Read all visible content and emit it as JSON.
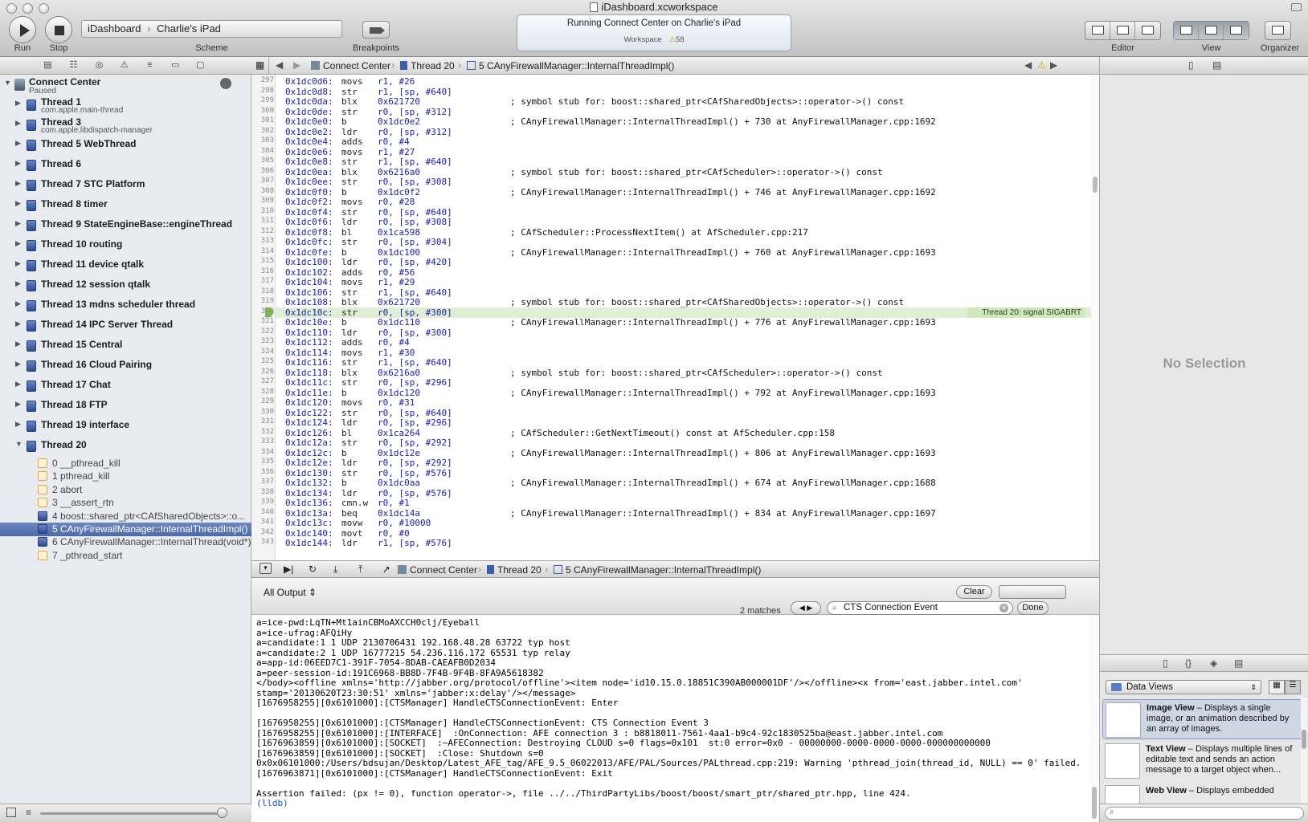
{
  "window": {
    "title": "iDashboard.xcworkspace"
  },
  "toolbar": {
    "run_label": "Run",
    "stop_label": "Stop",
    "scheme": {
      "project": "iDashboard",
      "device": "Charlie's iPad",
      "caption": "Scheme"
    },
    "breakpoints_label": "Breakpoints",
    "activity": {
      "status": "Running Connect Center on Charlie's iPad",
      "workspace_label": "Workspace",
      "warning_count": "58"
    },
    "editor_label": "Editor",
    "view_label": "View",
    "organizer_label": "Organizer"
  },
  "navigator": {
    "process": {
      "name": "Connect Center",
      "state": "Paused"
    },
    "threads": [
      {
        "name": "Thread 1",
        "sub": "com.apple.main-thread"
      },
      {
        "name": "Thread 3",
        "sub": "com.apple.libdispatch-manager"
      },
      {
        "name": "Thread 5 WebThread",
        "sub": ""
      },
      {
        "name": "Thread 6",
        "sub": ""
      },
      {
        "name": "Thread 7 STC Platform",
        "sub": ""
      },
      {
        "name": "Thread 8 timer",
        "sub": ""
      },
      {
        "name": "Thread 9 StateEngineBase::engineThread",
        "sub": ""
      },
      {
        "name": "Thread 10 routing",
        "sub": ""
      },
      {
        "name": "Thread 11 device qtalk",
        "sub": ""
      },
      {
        "name": "Thread 12 session qtalk",
        "sub": ""
      },
      {
        "name": "Thread 13 mdns scheduler thread",
        "sub": ""
      },
      {
        "name": "Thread 14 IPC Server Thread",
        "sub": ""
      },
      {
        "name": "Thread 15 Central",
        "sub": ""
      },
      {
        "name": "Thread 16 Cloud Pairing",
        "sub": ""
      },
      {
        "name": "Thread 17 Chat",
        "sub": ""
      },
      {
        "name": "Thread 18 FTP",
        "sub": ""
      },
      {
        "name": "Thread 19 interface",
        "sub": ""
      },
      {
        "name": "Thread 20",
        "sub": ""
      }
    ],
    "frames": [
      {
        "label": "0 __pthread_kill",
        "user": false
      },
      {
        "label": "1 pthread_kill",
        "user": false
      },
      {
        "label": "2 abort",
        "user": false
      },
      {
        "label": "3 __assert_rtn",
        "user": false
      },
      {
        "label": "4 boost::shared_ptr<CAfSharedObjects>::o...",
        "user": true
      },
      {
        "label": "5 CAnyFirewallManager::InternalThreadImpl()",
        "user": true
      },
      {
        "label": "6 CAnyFirewallManager::InternalThread(void*)",
        "user": true
      },
      {
        "label": "7 _pthread_start",
        "user": false
      }
    ]
  },
  "editor": {
    "jumpbar": {
      "project": "Connect Center",
      "thread": "Thread 20",
      "frame": "5 CAnyFirewallManager::InternalThreadImpl()"
    },
    "signal_label": "Thread 20: signal SIGABRT",
    "lines": [
      {
        "n": "297",
        "addr": "0x1dc0d6:",
        "op": "movs",
        "args": "r1, #26",
        "cm": ""
      },
      {
        "n": "298",
        "addr": "0x1dc0d8:",
        "op": "str",
        "args": "r1, [sp, #640]",
        "cm": ""
      },
      {
        "n": "299",
        "addr": "0x1dc0da:",
        "op": "blx",
        "args": "0x621720",
        "cm": "; symbol stub for: boost::shared_ptr<CAfSharedObjects>::operator->() const"
      },
      {
        "n": "300",
        "addr": "0x1dc0de:",
        "op": "str",
        "args": "r0, [sp, #312]",
        "cm": ""
      },
      {
        "n": "301",
        "addr": "0x1dc0e0:",
        "op": "b",
        "args": "0x1dc0e2",
        "cm": "; CAnyFirewallManager::InternalThreadImpl() + 730 at AnyFirewallManager.cpp:1692"
      },
      {
        "n": "302",
        "addr": "0x1dc0e2:",
        "op": "ldr",
        "args": "r0, [sp, #312]",
        "cm": ""
      },
      {
        "n": "303",
        "addr": "0x1dc0e4:",
        "op": "adds",
        "args": "r0, #4",
        "cm": ""
      },
      {
        "n": "304",
        "addr": "0x1dc0e6:",
        "op": "movs",
        "args": "r1, #27",
        "cm": ""
      },
      {
        "n": "305",
        "addr": "0x1dc0e8:",
        "op": "str",
        "args": "r1, [sp, #640]",
        "cm": ""
      },
      {
        "n": "306",
        "addr": "0x1dc0ea:",
        "op": "blx",
        "args": "0x6216a0",
        "cm": "; symbol stub for: boost::shared_ptr<CAfScheduler>::operator->() const"
      },
      {
        "n": "307",
        "addr": "0x1dc0ee:",
        "op": "str",
        "args": "r0, [sp, #308]",
        "cm": ""
      },
      {
        "n": "308",
        "addr": "0x1dc0f0:",
        "op": "b",
        "args": "0x1dc0f2",
        "cm": "; CAnyFirewallManager::InternalThreadImpl() + 746 at AnyFirewallManager.cpp:1692"
      },
      {
        "n": "309",
        "addr": "0x1dc0f2:",
        "op": "movs",
        "args": "r0, #28",
        "cm": ""
      },
      {
        "n": "310",
        "addr": "0x1dc0f4:",
        "op": "str",
        "args": "r0, [sp, #640]",
        "cm": ""
      },
      {
        "n": "311",
        "addr": "0x1dc0f6:",
        "op": "ldr",
        "args": "r0, [sp, #308]",
        "cm": ""
      },
      {
        "n": "312",
        "addr": "0x1dc0f8:",
        "op": "bl",
        "args": "0x1ca598",
        "cm": "; CAfScheduler::ProcessNextItem() at AfScheduler.cpp:217"
      },
      {
        "n": "313",
        "addr": "0x1dc0fc:",
        "op": "str",
        "args": "r0, [sp, #304]",
        "cm": ""
      },
      {
        "n": "314",
        "addr": "0x1dc0fe:",
        "op": "b",
        "args": "0x1dc100",
        "cm": "; CAnyFirewallManager::InternalThreadImpl() + 760 at AnyFirewallManager.cpp:1693"
      },
      {
        "n": "315",
        "addr": "0x1dc100:",
        "op": "ldr",
        "args": "r0, [sp, #420]",
        "cm": ""
      },
      {
        "n": "316",
        "addr": "0x1dc102:",
        "op": "adds",
        "args": "r0, #56",
        "cm": ""
      },
      {
        "n": "317",
        "addr": "0x1dc104:",
        "op": "movs",
        "args": "r1, #29",
        "cm": ""
      },
      {
        "n": "318",
        "addr": "0x1dc106:",
        "op": "str",
        "args": "r1, [sp, #640]",
        "cm": ""
      },
      {
        "n": "319",
        "addr": "0x1dc108:",
        "op": "blx",
        "args": "0x621720",
        "cm": "; symbol stub for: boost::shared_ptr<CAfSharedObjects>::operator->() const"
      },
      {
        "n": "320",
        "addr": "0x1dc10c:",
        "op": "str",
        "args": "r0, [sp, #300]",
        "cm": ""
      },
      {
        "n": "321",
        "addr": "0x1dc10e:",
        "op": "b",
        "args": "0x1dc110",
        "cm": "; CAnyFirewallManager::InternalThreadImpl() + 776 at AnyFirewallManager.cpp:1693"
      },
      {
        "n": "322",
        "addr": "0x1dc110:",
        "op": "ldr",
        "args": "r0, [sp, #300]",
        "cm": ""
      },
      {
        "n": "323",
        "addr": "0x1dc112:",
        "op": "adds",
        "args": "r0, #4",
        "cm": ""
      },
      {
        "n": "324",
        "addr": "0x1dc114:",
        "op": "movs",
        "args": "r1, #30",
        "cm": ""
      },
      {
        "n": "325",
        "addr": "0x1dc116:",
        "op": "str",
        "args": "r1, [sp, #640]",
        "cm": ""
      },
      {
        "n": "326",
        "addr": "0x1dc118:",
        "op": "blx",
        "args": "0x6216a0",
        "cm": "; symbol stub for: boost::shared_ptr<CAfScheduler>::operator->() const"
      },
      {
        "n": "327",
        "addr": "0x1dc11c:",
        "op": "str",
        "args": "r0, [sp, #296]",
        "cm": ""
      },
      {
        "n": "328",
        "addr": "0x1dc11e:",
        "op": "b",
        "args": "0x1dc120",
        "cm": "; CAnyFirewallManager::InternalThreadImpl() + 792 at AnyFirewallManager.cpp:1693"
      },
      {
        "n": "329",
        "addr": "0x1dc120:",
        "op": "movs",
        "args": "r0, #31",
        "cm": ""
      },
      {
        "n": "330",
        "addr": "0x1dc122:",
        "op": "str",
        "args": "r0, [sp, #640]",
        "cm": ""
      },
      {
        "n": "331",
        "addr": "0x1dc124:",
        "op": "ldr",
        "args": "r0, [sp, #296]",
        "cm": ""
      },
      {
        "n": "332",
        "addr": "0x1dc126:",
        "op": "bl",
        "args": "0x1ca264",
        "cm": "; CAfScheduler::GetNextTimeout() const at AfScheduler.cpp:158"
      },
      {
        "n": "333",
        "addr": "0x1dc12a:",
        "op": "str",
        "args": "r0, [sp, #292]",
        "cm": ""
      },
      {
        "n": "334",
        "addr": "0x1dc12c:",
        "op": "b",
        "args": "0x1dc12e",
        "cm": "; CAnyFirewallManager::InternalThreadImpl() + 806 at AnyFirewallManager.cpp:1693"
      },
      {
        "n": "335",
        "addr": "0x1dc12e:",
        "op": "ldr",
        "args": "r0, [sp, #292]",
        "cm": ""
      },
      {
        "n": "336",
        "addr": "0x1dc130:",
        "op": "str",
        "args": "r0, [sp, #576]",
        "cm": ""
      },
      {
        "n": "337",
        "addr": "0x1dc132:",
        "op": "b",
        "args": "0x1dc0aa",
        "cm": "; CAnyFirewallManager::InternalThreadImpl() + 674 at AnyFirewallManager.cpp:1688"
      },
      {
        "n": "338",
        "addr": "0x1dc134:",
        "op": "ldr",
        "args": "r0, [sp, #576]",
        "cm": ""
      },
      {
        "n": "339",
        "addr": "0x1dc136:",
        "op": "cmn.w",
        "args": "r0, #1",
        "cm": ""
      },
      {
        "n": "340",
        "addr": "0x1dc13a:",
        "op": "beq",
        "args": "0x1dc14a",
        "cm": "; CAnyFirewallManager::InternalThreadImpl() + 834 at AnyFirewallManager.cpp:1697"
      },
      {
        "n": "341",
        "addr": "0x1dc13c:",
        "op": "movw",
        "args": "r0, #10000",
        "cm": ""
      },
      {
        "n": "342",
        "addr": "0x1dc140:",
        "op": "movt",
        "args": "r0, #0",
        "cm": ""
      },
      {
        "n": "343",
        "addr": "0x1dc144:",
        "op": "ldr",
        "args": "r1, [sp, #576]",
        "cm": ""
      }
    ]
  },
  "debugbar": {
    "project": "Connect Center",
    "thread": "Thread 20",
    "frame": "5 CAnyFirewallManager::InternalThreadImpl()"
  },
  "console": {
    "output_selector": "All Output",
    "clear_label": "Clear",
    "match_count": "2 matches",
    "search_value": "CTS Connection Event",
    "done_label": "Done",
    "lines": [
      "a=ice-pwd:LqTN+Mt1ainCBMoAXCCH0clj/Eyeball",
      "a=ice-ufrag:AFQiHy",
      "a=candidate:1 1 UDP 2130706431 192.168.48.28 63722 typ host",
      "a=candidate:2 1 UDP 16777215 54.236.116.172 65531 typ relay",
      "a=app-id:06EED7C1-391F-7054-8DAB-CAEAFB0D2034",
      "a=peer-session-id:191C6968-BB8D-7F4B-9F4B-8FA9A5618382",
      "</body><offline xmlns='http://jabber.org/protocol/offline'><item node='id10.15.0.18851C390AB000001DF'/></offline><x from='east.jabber.intel.com'",
      "stamp='20130620T23:30:51' xmlns='jabber:x:delay'/></message>",
      "[1676958255][0x6101000]:[CTSManager] HandleCTSConnectionEvent: Enter",
      "",
      "[1676958255][0x6101000]:[CTSManager] HandleCTSConnectionEvent: CTS Connection Event 3",
      "[1676958255][0x6101000]:[INTERFACE]  :OnConnection: AFE connection 3 : b8818011-7561-4aa1-b9c4-92c1830525ba@east.jabber.intel.com",
      "[1676963859][0x6101000]:[SOCKET]  :~AFEConnection: Destroying CLOUD s=0 flags=0x101  st:0 error=0x0 - 00000000-0000-0000-0000-000000000000",
      "[1676963859][0x6101000]:[SOCKET]  :Close: Shutdown s=0",
      "0x0x06101000:/Users/bdsujan/Desktop/Latest_AFE_tag/AFE_9.5_06022013/AFE/PAL/Sources/PALthread.cpp:219: Warning 'pthread_join(thread_id, NULL) == 0' failed.",
      "[1676963871][0x6101000]:[CTSManager] HandleCTSConnectionEvent: Exit",
      "",
      "Assertion failed: (px != 0), function operator->, file ../../ThirdPartyLibs/boost/boost/smart_ptr/shared_ptr.hpp, line 424."
    ],
    "prompt": "(lldb)"
  },
  "utilities": {
    "no_selection": "No Selection",
    "library_selector": "Data Views",
    "library_items": [
      {
        "title": "Image View",
        "desc": " – Displays a single image, or an animation described by an array of images."
      },
      {
        "title": "Text View",
        "desc": " – Displays multiple lines of editable text and sends an action message to a target object when..."
      },
      {
        "title": "Web View",
        "desc": " – Displays embedded"
      }
    ]
  },
  "colors": {
    "accent": "#4d6aa8",
    "selection": "#6d88c0",
    "signal": "#cfe6bf",
    "address": "#1a22aa"
  }
}
